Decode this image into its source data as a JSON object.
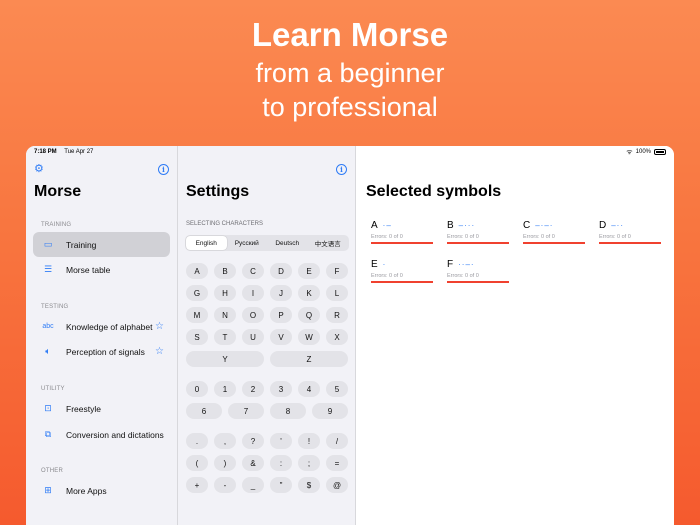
{
  "headline": {
    "title": "Learn Morse",
    "line2": "from a beginner",
    "line3": "to professional"
  },
  "status_bar": {
    "time": "7:18 PM",
    "date": "Tue Apr 27",
    "battery": "100%"
  },
  "sidebar": {
    "title": "Morse",
    "sections": [
      {
        "label": "TRAINING",
        "items": [
          {
            "label": "Training",
            "icon": "monitor-icon",
            "selected": true
          },
          {
            "label": "Morse table",
            "icon": "list-icon"
          }
        ]
      },
      {
        "label": "TESTING",
        "items": [
          {
            "label": "Knowledge of alphabet",
            "icon": "abc-icon",
            "starred": true
          },
          {
            "label": "Perception of signals",
            "icon": "speaker-icon",
            "starred": true
          }
        ]
      },
      {
        "label": "UTILITY",
        "items": [
          {
            "label": "Freestyle",
            "icon": "square-dot-icon"
          },
          {
            "label": "Conversion and dictations",
            "icon": "convert-icon"
          }
        ]
      },
      {
        "label": "OTHER",
        "items": [
          {
            "label": "More Apps",
            "icon": "grid-icon"
          }
        ]
      }
    ]
  },
  "settings": {
    "title": "Settings",
    "selecting_label": "SELECTING CHARACTERS",
    "languages": [
      "English",
      "Русский",
      "Deutsch",
      "中文语言"
    ],
    "active_language": "English",
    "letters": [
      "A",
      "B",
      "C",
      "D",
      "E",
      "F",
      "G",
      "H",
      "I",
      "J",
      "K",
      "L",
      "M",
      "N",
      "O",
      "P",
      "Q",
      "R",
      "S",
      "T",
      "U",
      "V",
      "W",
      "X",
      "Y",
      "Z"
    ],
    "digits": [
      "0",
      "1",
      "2",
      "3",
      "4",
      "5",
      "6",
      "7",
      "8",
      "9"
    ],
    "punctuation": [
      ".",
      ",",
      "?",
      "'",
      "!",
      "/",
      "(",
      ")",
      "&",
      ":",
      ";",
      "=",
      "+",
      "-",
      "_",
      "\"",
      "$",
      "@"
    ]
  },
  "selected": {
    "title": "Selected symbols",
    "symbols": [
      {
        "char": "A",
        "code": "·–",
        "errors": "Errors: 0 of 0"
      },
      {
        "char": "B",
        "code": "–···",
        "errors": "Errors: 0 of 0"
      },
      {
        "char": "C",
        "code": "–·–·",
        "errors": "Errors: 0 of 0"
      },
      {
        "char": "D",
        "code": "–··",
        "errors": "Errors: 0 of 0"
      },
      {
        "char": "E",
        "code": "·",
        "errors": "Errors: 0 of 0"
      },
      {
        "char": "F",
        "code": "··–·",
        "errors": "Errors: 0 of 0"
      }
    ]
  },
  "colors": {
    "accent": "#2f7cf6",
    "error_bar": "#f0412f",
    "background_orange": "#f8753f"
  }
}
